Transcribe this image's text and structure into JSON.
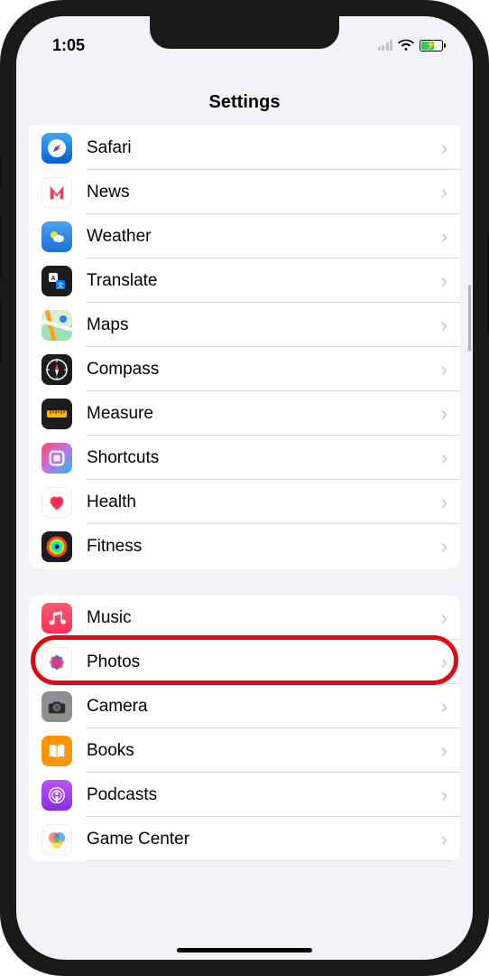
{
  "status": {
    "time": "1:05"
  },
  "nav": {
    "title": "Settings"
  },
  "groups": [
    {
      "rows": [
        {
          "id": "safari",
          "label": "Safari",
          "icon": "safari"
        },
        {
          "id": "news",
          "label": "News",
          "icon": "news"
        },
        {
          "id": "weather",
          "label": "Weather",
          "icon": "weather"
        },
        {
          "id": "translate",
          "label": "Translate",
          "icon": "translate"
        },
        {
          "id": "maps",
          "label": "Maps",
          "icon": "maps"
        },
        {
          "id": "compass",
          "label": "Compass",
          "icon": "compass"
        },
        {
          "id": "measure",
          "label": "Measure",
          "icon": "measure"
        },
        {
          "id": "shortcuts",
          "label": "Shortcuts",
          "icon": "shortcuts"
        },
        {
          "id": "health",
          "label": "Health",
          "icon": "health"
        },
        {
          "id": "fitness",
          "label": "Fitness",
          "icon": "fitness"
        }
      ]
    },
    {
      "rows": [
        {
          "id": "music",
          "label": "Music",
          "icon": "music"
        },
        {
          "id": "photos",
          "label": "Photos",
          "icon": "photos",
          "highlighted": true
        },
        {
          "id": "camera",
          "label": "Camera",
          "icon": "camera"
        },
        {
          "id": "books",
          "label": "Books",
          "icon": "books"
        },
        {
          "id": "podcasts",
          "label": "Podcasts",
          "icon": "podcasts"
        },
        {
          "id": "gamecenter",
          "label": "Game Center",
          "icon": "gamecenter"
        }
      ]
    }
  ],
  "colors": {
    "highlight": "#e30613"
  }
}
